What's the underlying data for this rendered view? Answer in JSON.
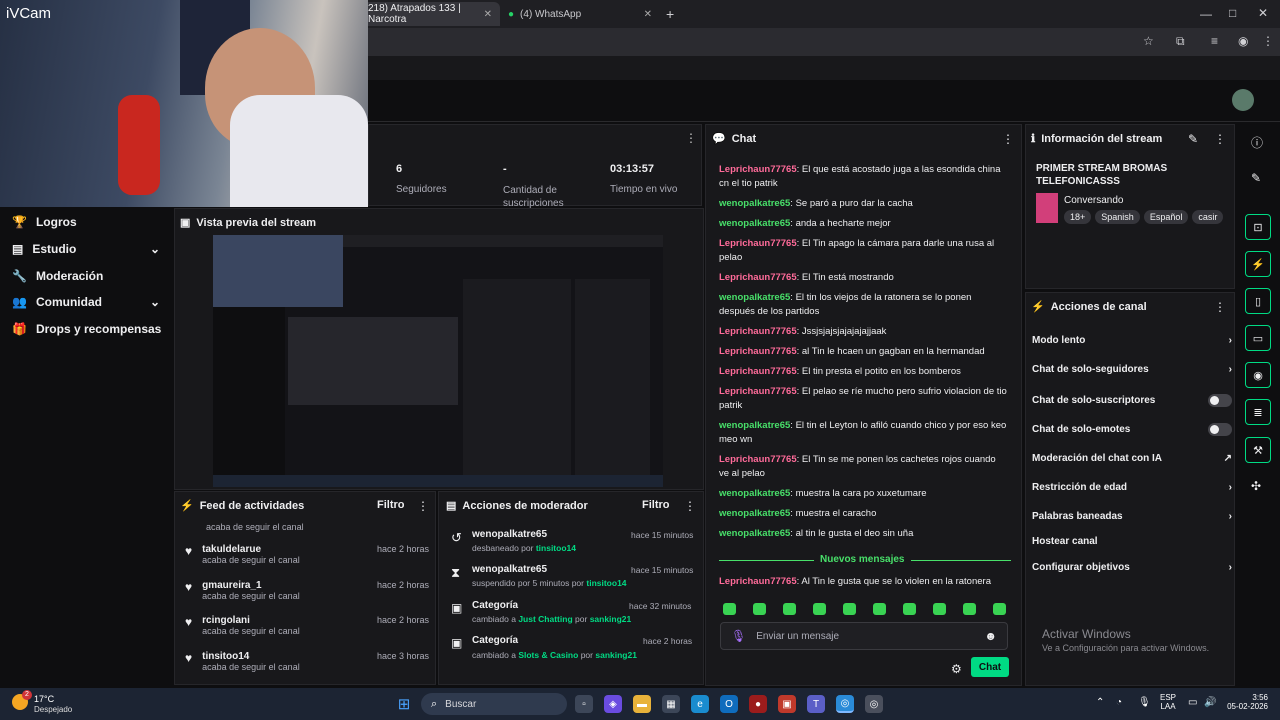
{
  "browser": {
    "tabs": [
      {
        "label": "218) Atrapados 133 | Narcotra",
        "active": true
      },
      {
        "label": "(4) WhatsApp",
        "active": false
      }
    ]
  },
  "overlay": {
    "title": "iVCam"
  },
  "stats": [
    {
      "value": "6",
      "label": "Seguidores"
    },
    {
      "value": "-",
      "label": "Cantidad de suscripciones"
    },
    {
      "value": "03:13:57",
      "label": "Tiempo en vivo"
    }
  ],
  "sidebar": {
    "items": [
      {
        "label": "Logros",
        "icon": "trophy-icon"
      },
      {
        "label": "Estudio",
        "icon": "film-icon",
        "expandable": true
      },
      {
        "label": "Moderación",
        "icon": "wrench-icon"
      },
      {
        "label": "Comunidad",
        "icon": "people-icon",
        "expandable": true
      },
      {
        "label": "Drops y recompensas",
        "icon": "gift-icon"
      }
    ]
  },
  "preview": {
    "title": "Vista previa del stream"
  },
  "feed": {
    "title": "Feed de actividades",
    "filter": "Filtro",
    "top_sub": "acaba de seguir el canal",
    "items": [
      {
        "user": "takuldelarue",
        "time": "hace 2 horas",
        "sub": "acaba de seguir el canal"
      },
      {
        "user": "gmaureira_1",
        "time": "hace 2 horas",
        "sub": "acaba de seguir el canal"
      },
      {
        "user": "rcingolani",
        "time": "hace 2 horas",
        "sub": "acaba de seguir el canal"
      },
      {
        "user": "tinsitoo14",
        "time": "hace 3 horas",
        "sub": "acaba de seguir el canal"
      }
    ]
  },
  "modactions": {
    "title": "Acciones de moderador",
    "filter": "Filtro",
    "items": [
      {
        "title": "wenopalkatre65",
        "time": "hace 15 minutos",
        "pre": "desbaneado por",
        "hl": "tinsitoo14",
        "post": "",
        "extra": "",
        "icon": "unban-icon"
      },
      {
        "title": "wenopalkatre65",
        "time": "hace 15 minutos",
        "pre": "suspendido por 5 minutos por",
        "hl": "tinsitoo14",
        "post": "",
        "extra": "",
        "icon": "hourglass-icon"
      },
      {
        "title": "Categoría",
        "time": "hace 32 minutos",
        "pre": "cambiado a",
        "hl": "Just Chatting",
        "post": "por",
        "extra": "sanking21",
        "icon": "category-icon"
      },
      {
        "title": "Categoría",
        "time": "hace 2 horas",
        "pre": "cambiado a",
        "hl": "Slots & Casino",
        "post": "por",
        "extra": "sanking21",
        "icon": "category-icon"
      }
    ]
  },
  "chat": {
    "title": "Chat",
    "messages": [
      {
        "user": "Leprichaun77765",
        "text": ": El que está acostado juga a las esondida china cn el tio patrik",
        "color": "pink"
      },
      {
        "user": "wenopalkatre65",
        "text": ": Se paró a puro dar la cacha",
        "color": "green"
      },
      {
        "user": "wenopalkatre65",
        "text": ": anda a hecharte mejor",
        "color": "green"
      },
      {
        "user": "Leprichaun77765",
        "text": ": El Tin apago la cámara para darle una rusa al pelao",
        "color": "pink"
      },
      {
        "user": "Leprichaun77765",
        "text": ": El Tin está mostrando",
        "color": "pink"
      },
      {
        "user": "wenopalkatre65",
        "text": ": El tin los viejos de la ratonera se lo ponen después de los partidos",
        "color": "green"
      },
      {
        "user": "Leprichaun77765",
        "text": ": Jssjsjajsjajajajajjaak",
        "color": "pink"
      },
      {
        "user": "Leprichaun77765",
        "text": ": al Tin le hcaen un gagban en la hermandad",
        "color": "pink"
      },
      {
        "user": "Leprichaun77765",
        "text": ": El tin presta el potito en los bomberos",
        "color": "pink"
      },
      {
        "user": "Leprichaun77765",
        "text": ": El pelao se ríe mucho pero sufrio violacion de tio patrik",
        "color": "pink"
      },
      {
        "user": "wenopalkatre65",
        "text": ": El tin el Leyton lo afiló cuando chico y por eso keo meo wn",
        "color": "green"
      },
      {
        "user": "Leprichaun77765",
        "text": ": El Tin se me ponen los cachetes rojos cuando ve al pelao",
        "color": "pink"
      },
      {
        "user": "wenopalkatre65",
        "text": ": muestra la cara po xuxetumare",
        "color": "green"
      },
      {
        "user": "wenopalkatre65",
        "text": ": muestra el caracho",
        "color": "green"
      },
      {
        "user": "wenopalkatre65",
        "text": ": al tin le gusta el deo sin uña",
        "color": "green"
      }
    ],
    "new_divider": "Nuevos mensajes",
    "last_message": {
      "user": "Leprichaun77765",
      "text": ": Al Tin le gusta que se lo violen en la ratonera"
    },
    "input_placeholder": "Enviar un mensaje",
    "send": "Chat"
  },
  "streaminfo": {
    "title": "Información del stream",
    "stream_title": "PRIMER STREAM BROMAS TELEFONICASSS",
    "category": "Conversando",
    "tags": [
      "18+",
      "Spanish",
      "Español",
      "casir"
    ]
  },
  "actions": {
    "title": "Acciones de canal",
    "items": [
      {
        "label": "Modo lento",
        "control": "chevron"
      },
      {
        "label": "Chat de solo-seguidores",
        "control": "chevron"
      },
      {
        "label": "Chat de solo-suscriptores",
        "control": "toggle"
      },
      {
        "label": "Chat de solo-emotes",
        "control": "toggle"
      },
      {
        "label": "Moderación del chat con IA",
        "control": "external"
      },
      {
        "label": "Restricción de edad",
        "control": "chevron"
      },
      {
        "label": "Palabras baneadas",
        "control": "chevron"
      },
      {
        "label": "Hostear canal",
        "control": "none"
      },
      {
        "label": "Configurar objetivos",
        "control": "chevron"
      }
    ]
  },
  "watermark": {
    "title": "Activar Windows",
    "sub": "Ve a Configuración para activar Windows."
  },
  "taskbar": {
    "temp": "17°C",
    "weather": "Despejado",
    "search": "Buscar",
    "lang1": "ESP",
    "lang2": "LAA",
    "time": "3:56",
    "date": "05-02-2026",
    "badge": "2"
  },
  "colors": {
    "accent": "#00db84",
    "bg": "#0e0e10",
    "panel": "#18181b"
  }
}
